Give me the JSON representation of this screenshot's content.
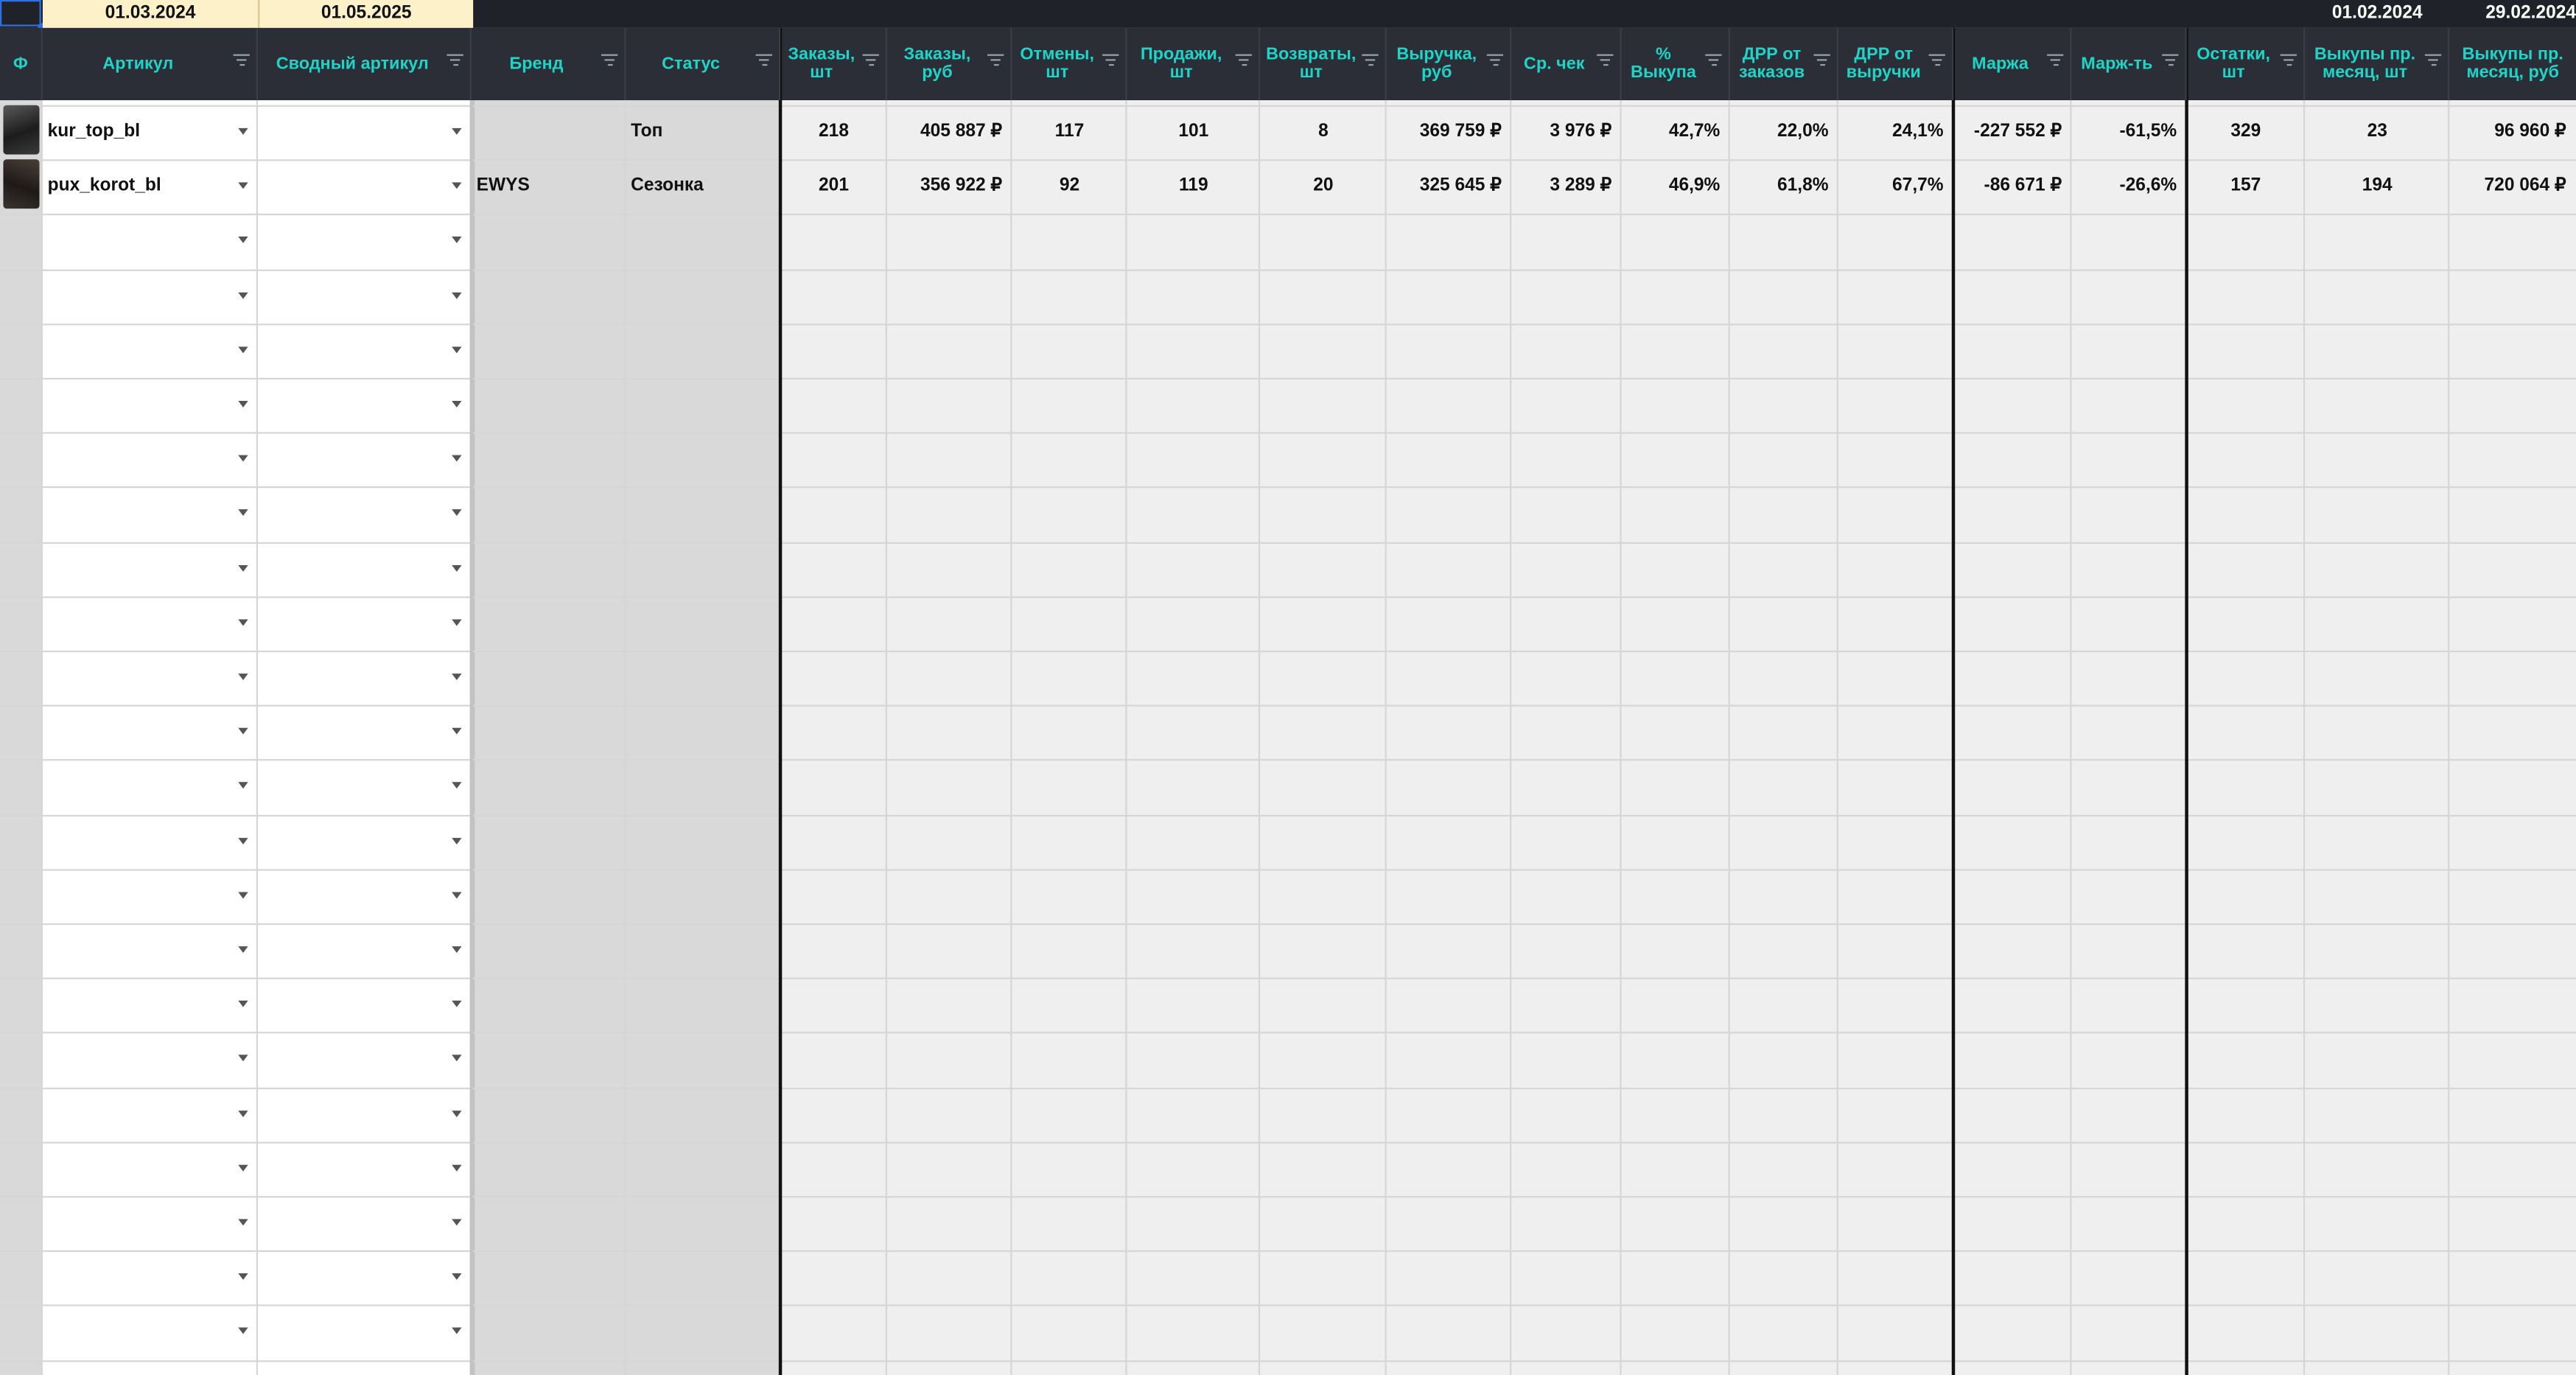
{
  "dates": {
    "period_start": "01.03.2024",
    "period_end": "01.05.2025",
    "prev_start": "01.02.2024",
    "prev_end": "29.02.2024"
  },
  "headers": {
    "photo": "Ф",
    "article": "Артикул",
    "summary_article": "Сводный артикул",
    "brand": "Бренд",
    "status": "Статус",
    "orders_qty": "Заказы, шт",
    "orders_rub": "Заказы, руб",
    "cancels_qty": "Отмены, шт",
    "sales_qty": "Продажи, шт",
    "returns_qty": "Возвраты, шт",
    "revenue_rub": "Выручка, руб",
    "avg_check": "Ср. чек",
    "buyout_pct": "% Выкупа",
    "drr_orders": "ДРР от заказов",
    "drr_revenue": "ДРР от выручки",
    "margin": "Маржа",
    "marginality": "Марж-ть",
    "stock_qty": "Остатки, шт",
    "prev_buyouts_qty": "Выкупы пр. месяц, шт",
    "prev_buyouts_rub": "Выкупы пр. месяц, руб"
  },
  "rows": [
    {
      "article": "kur_top_bl",
      "summary_article": "",
      "brand": "",
      "status": "Топ",
      "orders_qty": "218",
      "orders_rub": "405 887 ₽",
      "cancels_qty": "117",
      "sales_qty": "101",
      "returns_qty": "8",
      "revenue_rub": "369 759 ₽",
      "avg_check": "3 976 ₽",
      "buyout_pct": "42,7%",
      "drr_orders": "22,0%",
      "drr_revenue": "24,1%",
      "margin": "-227 552 ₽",
      "marginality": "-61,5%",
      "stock_qty": "329",
      "prev_buyouts_qty": "23",
      "prev_buyouts_rub": "96 960 ₽"
    },
    {
      "article": "pux_korot_bl",
      "summary_article": "",
      "brand": "EWYS",
      "status": "Сезонка",
      "orders_qty": "201",
      "orders_rub": "356 922 ₽",
      "cancels_qty": "92",
      "sales_qty": "119",
      "returns_qty": "20",
      "revenue_rub": "325 645 ₽",
      "avg_check": "3 289 ₽",
      "buyout_pct": "46,9%",
      "drr_orders": "61,8%",
      "drr_revenue": "67,7%",
      "margin": "-86 671 ₽",
      "marginality": "-26,6%",
      "stock_qty": "157",
      "prev_buyouts_qty": "194",
      "prev_buyouts_rub": "720 064 ₽"
    }
  ],
  "colors": {
    "header_bg": "#2b2e36",
    "header_text": "#1fd4c7",
    "date_highlight": "#fcf1c9",
    "grid_bg": "#efefef",
    "gray_block": "#d9d9d9"
  }
}
